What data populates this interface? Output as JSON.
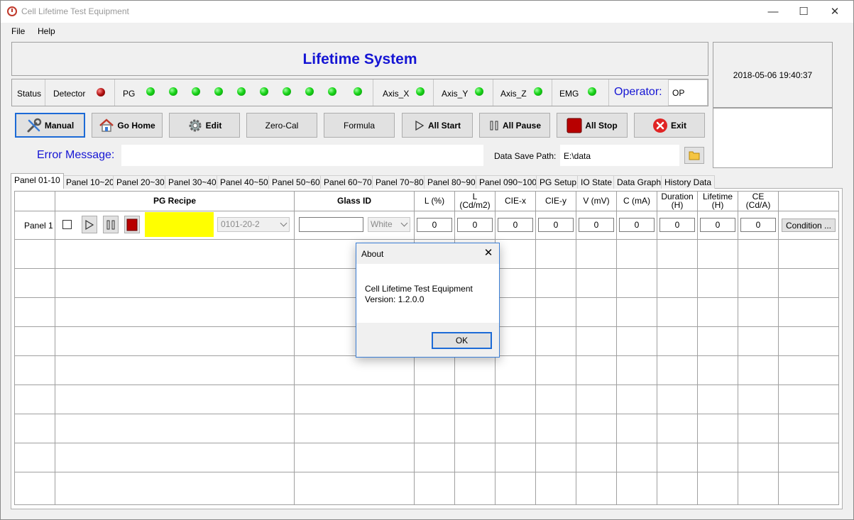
{
  "window": {
    "title": "Cell Lifetime Test Equipment",
    "minimize_glyph": "—",
    "maximize_glyph": "☐",
    "close_glyph": "✕"
  },
  "menu": [
    "File",
    "Help"
  ],
  "header": {
    "system_title": "Lifetime System",
    "datetime": "2018-05-06 19:40:37"
  },
  "status": {
    "status_label": "Status",
    "detector_label": "Detector",
    "detector_state": "red",
    "pg_label": "PG",
    "pg_leds": [
      "green",
      "green",
      "green",
      "green",
      "green",
      "green",
      "green",
      "green",
      "green",
      "green"
    ],
    "axis_x_label": "Axis_X",
    "axis_y_label": "Axis_Y",
    "axis_z_label": "Axis_Z",
    "emg_label": "EMG",
    "operator_label": "Operator:",
    "operator_value": "OP"
  },
  "toolbar": {
    "manual": "Manual",
    "go_home": "Go Home",
    "edit": "Edit",
    "zero_cal": "Zero-Cal",
    "formula": "Formula",
    "all_start": "All Start",
    "all_pause": "All Pause",
    "all_stop": "All Stop",
    "exit": "Exit"
  },
  "error": {
    "label": "Error Message:",
    "value": ""
  },
  "save_path": {
    "label": "Data Save Path:",
    "value": "E:\\data"
  },
  "tabs": [
    "Panel 01-10",
    "Panel 10~20",
    "Panel 20~30",
    "Panel 30~40",
    "Panel 40~50",
    "Panel 50~60",
    "Panel 60~70",
    "Panel 70~80",
    "Panel 80~90",
    "Panel 090~100",
    "PG Setup",
    "IO State",
    "Data Graph",
    "History Data"
  ],
  "active_tab": "Panel 01-10",
  "grid": {
    "headers": {
      "pg_recipe": "PG Recipe",
      "glass_id": "Glass ID",
      "l_pct": "L (%)",
      "l_cdm2": "L\n(Cd/m2)",
      "cie_x": "CIE-x",
      "cie_y": "CIE-y",
      "v_mv": "V (mV)",
      "c_ma": "C (mA)",
      "duration": "Duration\n(H)",
      "lifetime": "Lifetime\n(H)",
      "ce": "CE\n(Cd/A)"
    },
    "row1": {
      "panel": "Panel 1",
      "recipe": "0101-20-2",
      "glass_id": "",
      "color": "White",
      "l_pct": "0",
      "l_cdm2": "0",
      "cie_x": "0",
      "cie_y": "0",
      "v_mv": "0",
      "c_ma": "0",
      "duration": "0",
      "lifetime": "0",
      "ce": "0",
      "condition": "Condition ..."
    }
  },
  "dialog": {
    "title": "About",
    "line1": "Cell Lifetime Test Equipment",
    "line2": "Version: 1.2.0.0",
    "ok": "OK"
  }
}
